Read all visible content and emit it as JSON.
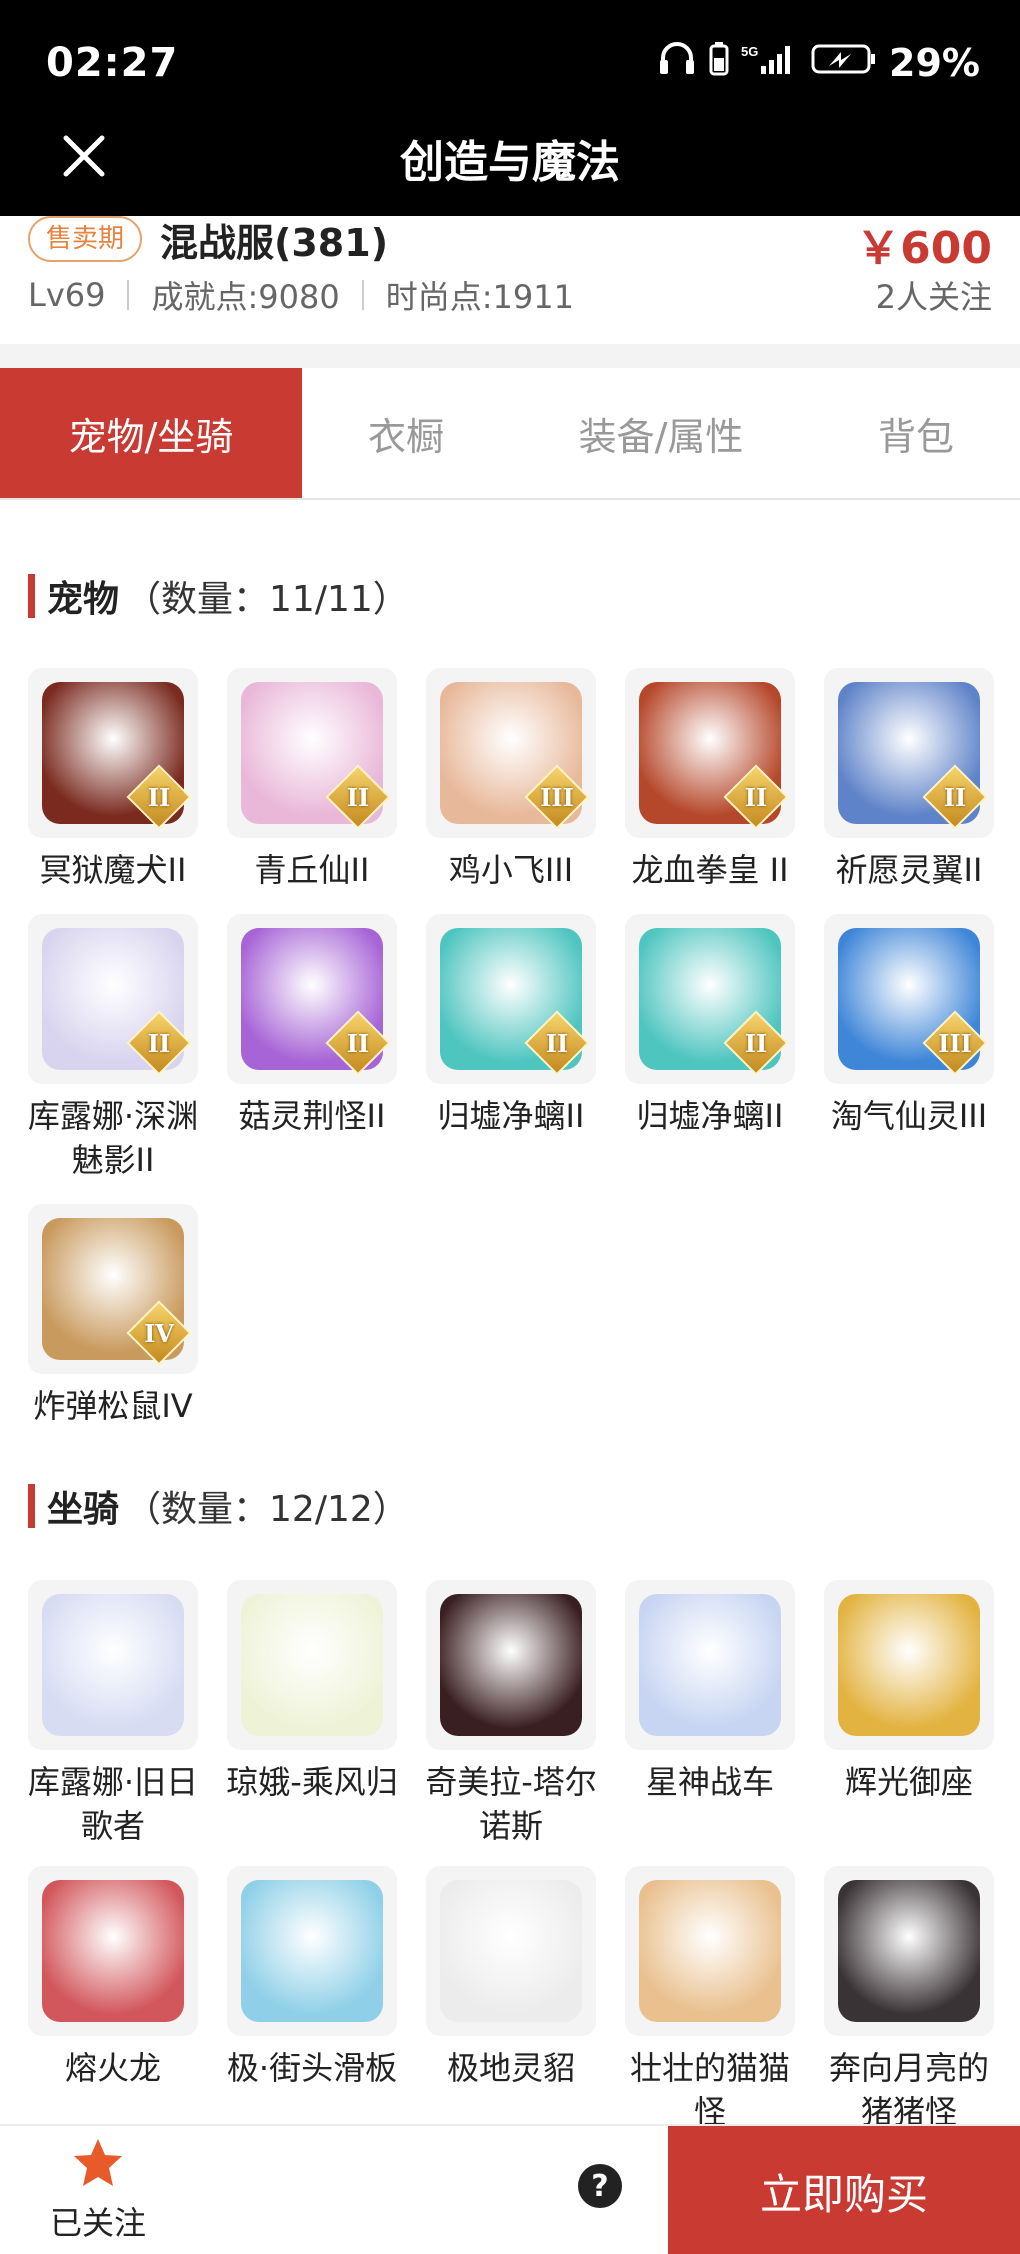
{
  "status": {
    "time": "02:27",
    "network": "5G",
    "battery": "29%"
  },
  "app": {
    "title": "创造与魔法"
  },
  "listing": {
    "badge": "售卖期",
    "server": "混战服(381)",
    "price": "￥600",
    "level": "Lv69",
    "achievement": "成就点:9080",
    "fashion": "时尚点:1911",
    "followers": "2人关注"
  },
  "tabs": [
    {
      "label": "宠物/坐骑",
      "active": true
    },
    {
      "label": "衣橱",
      "active": false
    },
    {
      "label": "装备/属性",
      "active": false
    },
    {
      "label": "背包",
      "active": false
    }
  ],
  "pets": {
    "title": "宠物",
    "count": "（数量：11/11）",
    "items": [
      {
        "name": "冥狱魔犬II",
        "tier": "II",
        "color": "#7a2a1f"
      },
      {
        "name": "青丘仙II",
        "tier": "II",
        "color": "#e9b7d8"
      },
      {
        "name": "鸡小飞III",
        "tier": "III",
        "color": "#e8b89a"
      },
      {
        "name": "龙血拳皇 II",
        "tier": "II",
        "color": "#b5472a"
      },
      {
        "name": "祈愿灵翼II",
        "tier": "II",
        "color": "#5f83c9"
      },
      {
        "name": "库露娜·深渊魅影II",
        "tier": "II",
        "color": "#d8d4ef"
      },
      {
        "name": "菇灵荆怪II",
        "tier": "II",
        "color": "#a764d6"
      },
      {
        "name": "归墟净螭II",
        "tier": "II",
        "color": "#4fc5c0"
      },
      {
        "name": "归墟净螭II",
        "tier": "II",
        "color": "#4fc5c0"
      },
      {
        "name": "淘气仙灵III",
        "tier": "III",
        "color": "#3f86d8"
      },
      {
        "name": "炸弹松鼠IV",
        "tier": "IV",
        "color": "#c99a5e"
      }
    ]
  },
  "mounts": {
    "title": "坐骑",
    "count": "（数量：12/12）",
    "items": [
      {
        "name": "库露娜·旧日歌者",
        "color": "#d7dcf3"
      },
      {
        "name": "琼娥-乘风归",
        "color": "#eef3d8"
      },
      {
        "name": "奇美拉-塔尔诺斯",
        "color": "#3a1f22"
      },
      {
        "name": "星神战车",
        "color": "#c7d4f2"
      },
      {
        "name": "辉光御座",
        "color": "#e3b341"
      },
      {
        "name": "熔火龙",
        "color": "#d2575c"
      },
      {
        "name": "极·街头滑板",
        "color": "#8fd0e8"
      },
      {
        "name": "极地灵貂",
        "color": "#ececec"
      },
      {
        "name": "壮壮的猫猫怪",
        "color": "#e9c08e"
      },
      {
        "name": "奔向月亮的猪猪怪",
        "color": "#3a3335"
      }
    ]
  },
  "bottom": {
    "follow_label": "已关注",
    "help": "?",
    "buy_label": "立即购买"
  }
}
